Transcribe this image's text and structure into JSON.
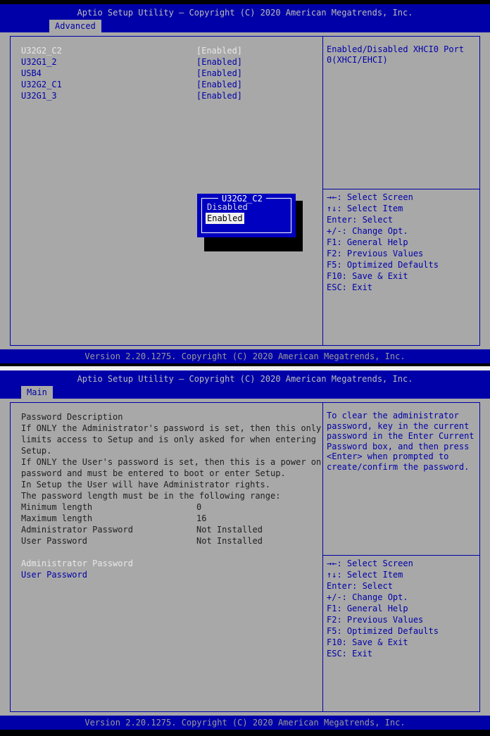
{
  "common": {
    "header_title": "Aptio Setup Utility – Copyright (C) 2020 American Megatrends, Inc.",
    "footer_text": "Version 2.20.1275. Copyright (C) 2020 American Megatrends, Inc.",
    "colors": {
      "blue": "#0000a8",
      "gray": "#a8a8a8",
      "black": "#000000",
      "white": "#e8e8e8",
      "dialog_blue": "#0000c0"
    },
    "nav_keys": [
      "→←: Select Screen",
      "↑↓: Select Item",
      "Enter: Select",
      "+/-: Change Opt.",
      "F1: General Help",
      "F2: Previous Values",
      "F5: Optimized Defaults",
      "F10: Save & Exit",
      "ESC: Exit"
    ]
  },
  "screen1": {
    "tab": "Advanced",
    "items": [
      {
        "label": "U32G2_C2",
        "value": "[Enabled]",
        "selected": true
      },
      {
        "label": "U32G1_2",
        "value": "[Enabled]",
        "selected": false
      },
      {
        "label": "USB4",
        "value": "[Enabled]",
        "selected": false
      },
      {
        "label": "U32G2_C1",
        "value": "[Enabled]",
        "selected": false
      },
      {
        "label": "U32G1_3",
        "value": "[Enabled]",
        "selected": false
      }
    ],
    "help_lines": [
      "Enabled/Disabled XHCI0 Port",
      "0(XHCI/EHCI)"
    ],
    "dialog": {
      "title": "U32G2_C2",
      "options": [
        {
          "label": "Disabled",
          "selected": false
        },
        {
          "label": "Enabled",
          "selected": true
        }
      ]
    }
  },
  "screen2": {
    "tab": "Main",
    "description_lines": [
      "Password Description",
      "If ONLY the Administrator's password is set, then this only",
      "limits access to Setup and is only asked for when entering",
      "Setup.",
      "If ONLY the User's password is set, then this is a power on",
      "password and must be entered to boot or enter Setup.",
      "In Setup the User will have Administrator rights.",
      "The password length must be in the following range:"
    ],
    "info_rows": [
      {
        "label": "Minimum length",
        "value": "0"
      },
      {
        "label": "Maximum length",
        "value": "16"
      },
      {
        "label": "Administrator Password",
        "value": "Not Installed"
      },
      {
        "label": "User Password",
        "value": "Not Installed"
      }
    ],
    "menu_items": [
      {
        "label": "Administrator Password",
        "selected": true
      },
      {
        "label": "User Password",
        "selected": false
      }
    ],
    "help_lines": [
      "To clear the administrator",
      "password, key in the current",
      "password in the Enter Current",
      "Password box, and then press",
      "<Enter> when prompted to",
      "create/confirm the password."
    ]
  }
}
